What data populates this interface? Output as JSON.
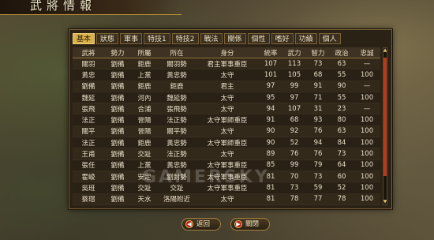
{
  "window": {
    "title": "武將情報"
  },
  "tabs": [
    {
      "label": "基本",
      "active": true
    },
    {
      "label": "狀態",
      "active": false
    },
    {
      "label": "軍事",
      "active": false
    },
    {
      "label": "特技1",
      "active": false
    },
    {
      "label": "特技2",
      "active": false
    },
    {
      "label": "戰法",
      "active": false
    },
    {
      "label": "關係",
      "active": false
    },
    {
      "label": "個性",
      "active": false
    },
    {
      "label": "嗜好",
      "active": false
    },
    {
      "label": "功績",
      "active": false
    },
    {
      "label": "個人",
      "active": false
    }
  ],
  "table": {
    "headers": [
      "武將",
      "勢力",
      "所屬",
      "所在",
      "身分",
      "統率",
      "武力",
      "智力",
      "政治",
      "忠誠"
    ],
    "rows": [
      [
        "關羽",
        "劉備",
        "鉅鹿",
        "關羽勢",
        "君主軍事重臣",
        "107",
        "113",
        "73",
        "63",
        "—"
      ],
      [
        "黃忠",
        "劉備",
        "上黨",
        "黃忠勢",
        "太守",
        "101",
        "105",
        "68",
        "55",
        "100"
      ],
      [
        "劉備",
        "劉備",
        "鉅鹿",
        "鉅鹿",
        "君主",
        "97",
        "99",
        "91",
        "90",
        "—"
      ],
      [
        "魏延",
        "劉備",
        "河內",
        "魏延勢",
        "太守",
        "95",
        "97",
        "71",
        "55",
        "100"
      ],
      [
        "張飛",
        "劉備",
        "合浦",
        "張飛勢",
        "太守",
        "94",
        "107",
        "31",
        "23",
        "—"
      ],
      [
        "法正",
        "劉備",
        "晉陽",
        "法正勢",
        "太守軍師重臣",
        "91",
        "68",
        "93",
        "80",
        "100"
      ],
      [
        "關平",
        "劉備",
        "晉陽",
        "關平勢",
        "太守",
        "90",
        "92",
        "76",
        "63",
        "100"
      ],
      [
        "法正",
        "劉備",
        "鉅鹿",
        "黃忠勢",
        "太守軍師重臣",
        "90",
        "52",
        "94",
        "84",
        "100"
      ],
      [
        "王甫",
        "劉備",
        "交趾",
        "法正勢",
        "太守",
        "89",
        "76",
        "76",
        "73",
        "100"
      ],
      [
        "張任",
        "劉備",
        "上黨",
        "黃忠勢",
        "太守軍事重臣",
        "85",
        "99",
        "79",
        "64",
        "100"
      ],
      [
        "霍峻",
        "劉備",
        "安定",
        "劉封勢",
        "太守軍事重臣",
        "81",
        "70",
        "73",
        "60",
        "100"
      ],
      [
        "吳班",
        "劉備",
        "交趾",
        "交趾",
        "太守軍事重臣",
        "81",
        "73",
        "59",
        "52",
        "100"
      ],
      [
        "蔡瑁",
        "劉備",
        "天水",
        "洛陽附近",
        "太守",
        "81",
        "78",
        "77",
        "78",
        "100"
      ]
    ]
  },
  "buttons": {
    "back": "返回",
    "close": "關閉"
  },
  "watermark": "GAMERSKY"
}
